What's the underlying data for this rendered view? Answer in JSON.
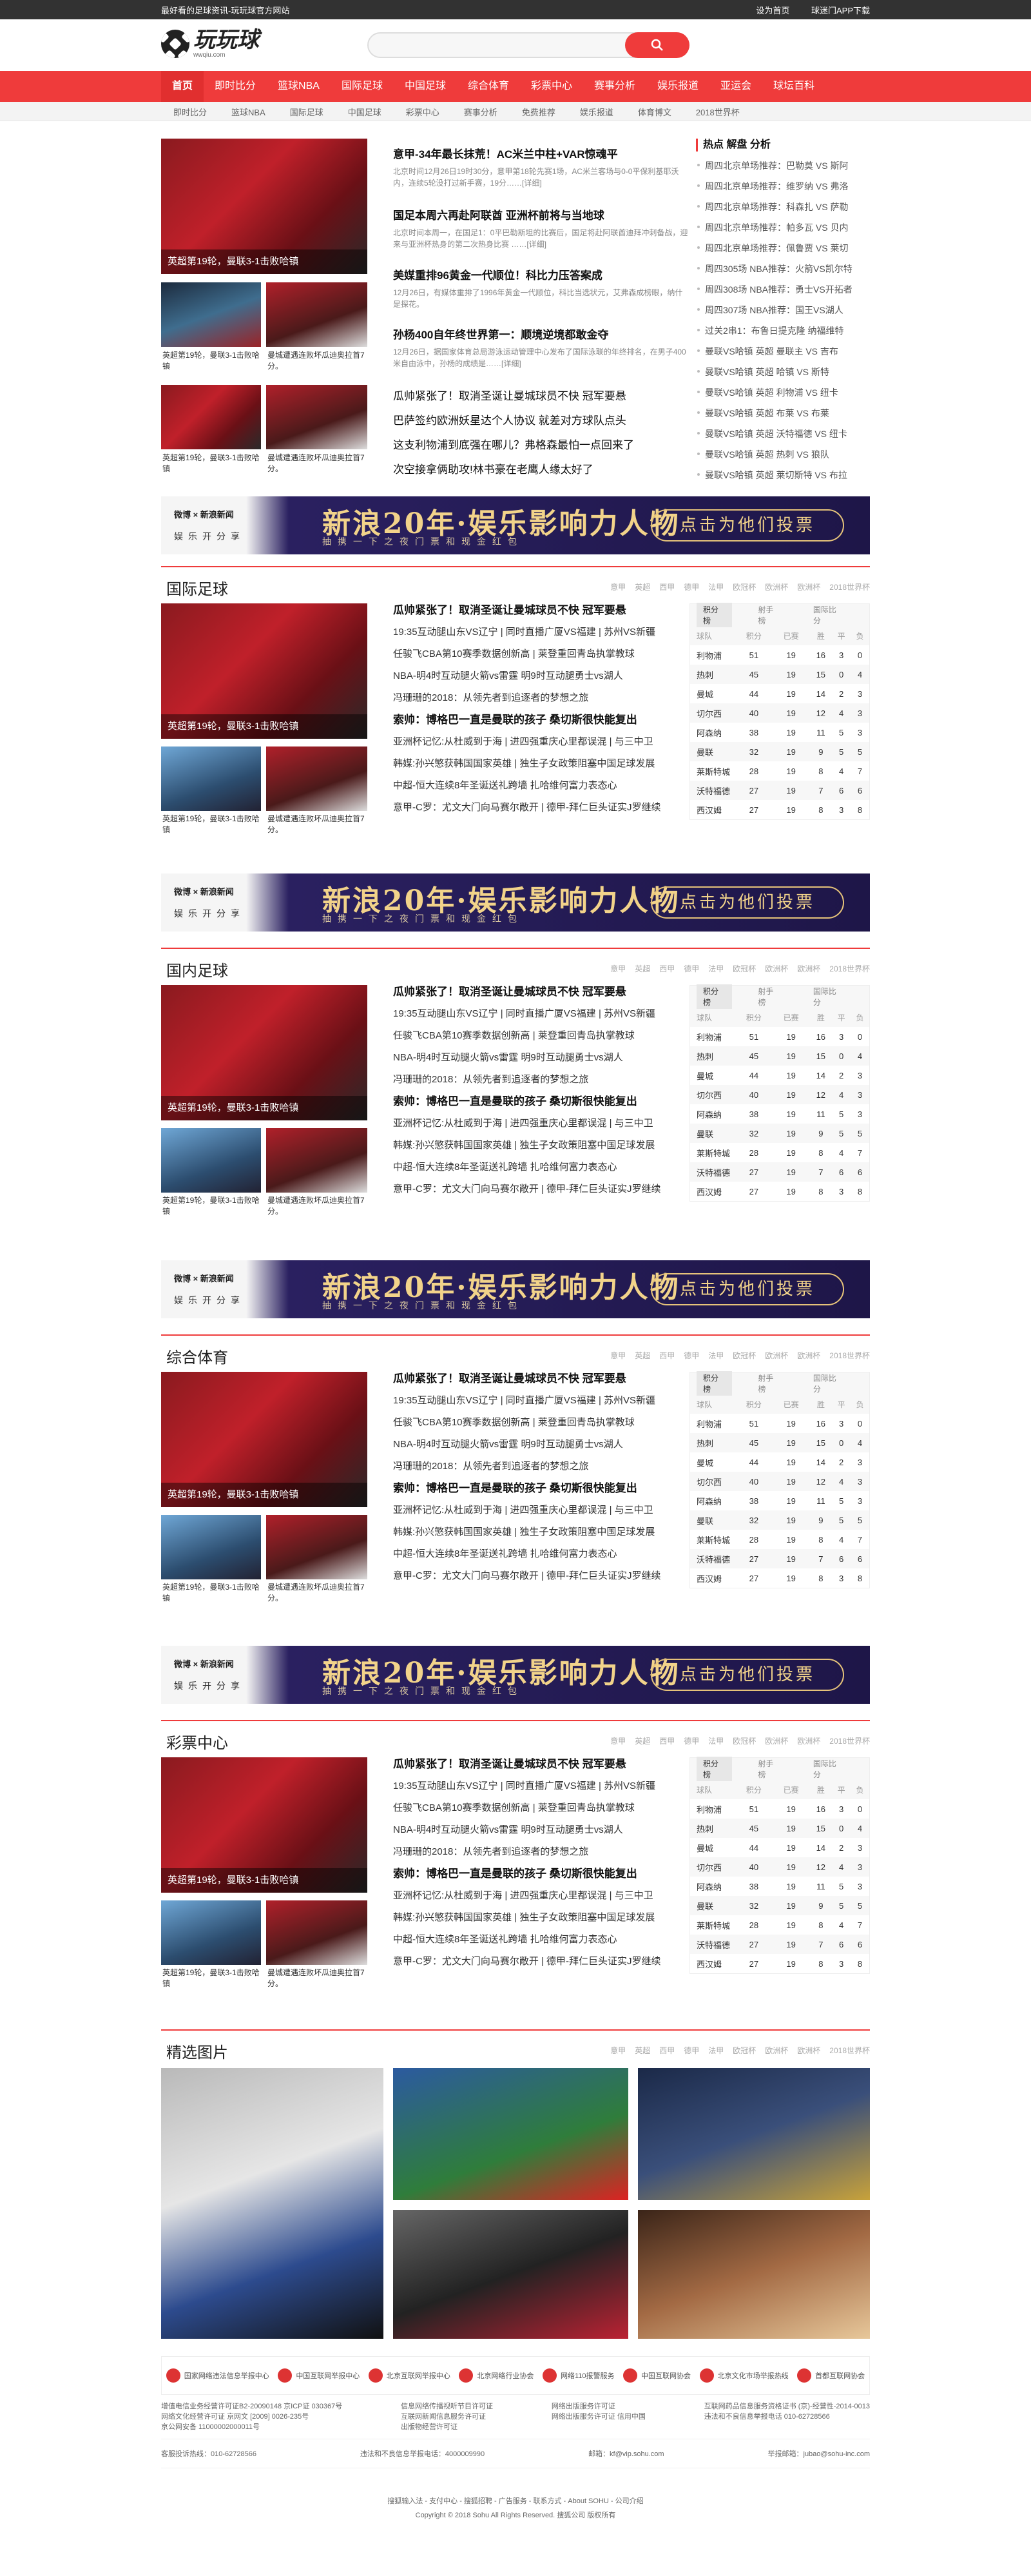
{
  "topbar": {
    "left": "最好看的足球资讯-玩玩球官方网站",
    "right1": "设为首页",
    "right2": "球迷门APP下载"
  },
  "logo": {
    "name": "玩玩球",
    "domain": "wwqiu.com"
  },
  "search": {
    "placeholder": "",
    "button_icon": "search-icon"
  },
  "nav": [
    "首页",
    "即时比分",
    "篮球NBA",
    "国际足球",
    "中国足球",
    "综合体育",
    "彩票中心",
    "赛事分析",
    "娱乐报道",
    "亚运会",
    "球坛百科"
  ],
  "subnav": [
    "即时比分",
    "篮球NBA",
    "国际足球",
    "中国足球",
    "彩票中心",
    "赛事分析",
    "免费推荐",
    "娱乐报道",
    "体育博文",
    "2018世界杯"
  ],
  "top": {
    "main_cap": "英超第19轮，曼联3-1击败哈镇",
    "small1": "英超第19轮，曼联3-1击败哈镇",
    "small2": "曼城遭遇连败坏瓜迪奥拉首7分。",
    "small3": "英超第19轮，曼联3-1击败哈镇",
    "small4": "曼城遭遇连败坏瓜迪奥拉首7分。",
    "h1": "意甲-34年最长抹荒！AC米兰中柱+VAR惊魂平",
    "s1": "北京时间12月26日19时30分，意甲第18轮先赛1场，AC米兰客场与0-0平保利基耶沃内，连续5轮没打过新手赛，19分……[详细]",
    "h2": "国足本周六再赴阿联酋 亚洲杯前将与当地球",
    "s2": "北京时间本周一，在国足1：0平巴勒斯坦的比赛后，国足将赴阿联酋迪拜冲刺备战，迎来与亚洲杯热身的第二次热身比赛 ……[详细]",
    "h3": "美媒重排96黄金一代顺位！科比力压答案成",
    "s3": "12月26日，有媒体重排了1996年黄金一代顺位，科比当选状元，艾弗森成榜眼，纳什是探花。",
    "h4": "孙杨400自年终世界第一：顺境逆境都敢金夺",
    "s4": "12月26日，据国家体育总局游泳运动管理中心发布了国际泳联的年终排名，在男子400米自由泳中，孙杨的成绩是……[详细]",
    "l1": "瓜帅紧张了！取消圣诞让曼城球员不快 冠军要悬",
    "l2": "巴萨签约欧洲妖星达个人协议 就差对方球队点头",
    "l3": "这支利物浦到底强在哪儿？弗格森最怕一点回来了",
    "l4": "次空接拿俩助攻!林书豪在老鹰人缘太好了"
  },
  "hot": {
    "title": "热点 解盘 分析",
    "items": [
      "周四北京单场推荐：巴勒莫 VS 斯阿",
      "周四北京单场推荐：维罗纳 VS 弗洛",
      "周四北京单场推荐：科森扎 VS 萨勒",
      "周四北京单场推荐：帕多瓦 VS 贝内",
      "周四北京单场推荐：佩鲁贾 VS 莱切",
      "周四305场 NBA推荐：火箭VS凯尔特",
      "周四308场 NBA推荐：勇士VS开拓者",
      "周四307场 NBA推荐：国王VS湖人",
      "过关2串1：布鲁日提克隆 纳福维特",
      "曼联VS哈镇 英超 曼联主 VS 吉布",
      "曼联VS哈镇 英超 哈镇 VS 斯特",
      "曼联VS哈镇 英超 利物浦 VS 纽卡",
      "曼联VS哈镇 英超 布莱 VS 布莱",
      "曼联VS哈镇 英超 沃特福德 VS 纽卡",
      "曼联VS哈镇 英超 热刺 VS 狼队",
      "曼联VS哈镇 英超 莱切斯特 VS 布拉"
    ]
  },
  "ad": {
    "logos": "微博 × 新浪新闻",
    "sub": "娱乐开分享",
    "big": "新浪20年·娱乐影响力人物",
    "sub2": "抽携一下之夜门票和现金红包",
    "vote": "点击为他们投票"
  },
  "sections": [
    {
      "title": "国际足球"
    },
    {
      "title": "国内足球"
    },
    {
      "title": "综合体育"
    },
    {
      "title": "彩票中心"
    }
  ],
  "tags": [
    "意甲",
    "英超",
    "西甲",
    "德甲",
    "法甲",
    "欧冠杯",
    "欧洲杯",
    "欧洲杯",
    "2018世界杯"
  ],
  "sec": {
    "big_cap": "英超第19轮，曼联3-1击败哈镇",
    "cap1": "英超第19轮，曼联3-1击败哈镇",
    "cap2": "曼城遭遇连败坏瓜迪奥拉首7分。",
    "b1": "瓜帅紧张了！取消圣诞让曼城球员不快 冠军要悬",
    "n1": "19:35互动腿山东VS辽宁 | 同时直播广厦VS福建 | 苏州VS新疆",
    "n2": "任骏飞CBA第10赛季数据创新高 | 莱登重回青岛执掌教球",
    "n3": "NBA-明4时互动腿火箭vs雷霆 明9时互动腿勇士vs湖人",
    "n4": "冯珊珊的2018：从领先者到追逐者的梦想之旅",
    "b2": "索帅：博格巴一直是曼联的孩子 桑切斯很快能复出",
    "n5": "亚洲杯记忆:从杜威到于海 | 进四强重庆心里都误混 | 与三中卫",
    "n6": "韩媒:孙兴慜获韩国国家英雄 | 独生子女政策阻塞中国足球发展",
    "n7": "中超-恒大连续8年圣诞送礼跨墙 扎哈维何富力表态心",
    "n8": "意甲-C罗：尤文大门向马赛尔敞开 | 德甲-拜仁巨头证实J罗继续"
  },
  "table": {
    "tab1": "积分榜",
    "tab2": "射手榜",
    "tab3": "国际比分",
    "head": [
      "球队",
      "积分",
      "已赛",
      "胜",
      "平",
      "负"
    ],
    "rows": [
      [
        "利物浦",
        "51",
        "19",
        "16",
        "3",
        "0"
      ],
      [
        "热刺",
        "45",
        "19",
        "15",
        "0",
        "4"
      ],
      [
        "曼城",
        "44",
        "19",
        "14",
        "2",
        "3"
      ],
      [
        "切尔西",
        "40",
        "19",
        "12",
        "4",
        "3"
      ],
      [
        "阿森纳",
        "38",
        "19",
        "11",
        "5",
        "3"
      ],
      [
        "曼联",
        "32",
        "19",
        "9",
        "5",
        "5"
      ],
      [
        "莱斯特城",
        "28",
        "19",
        "8",
        "4",
        "7"
      ],
      [
        "沃特福德",
        "27",
        "19",
        "7",
        "6",
        "6"
      ],
      [
        "西汉姆",
        "27",
        "19",
        "8",
        "3",
        "8"
      ]
    ]
  },
  "gallery": {
    "title": "精选图片"
  },
  "footer": {
    "logos": [
      "国家网络违法信息举报中心",
      "中国互联网举报中心",
      "北京互联网举报中心",
      "北京网络行业协会",
      "网络110报警服务",
      "中国互联网协会",
      "北京文化市场举报热线",
      "首都互联网协会"
    ],
    "c1": "增值电信业务经营许可证B2-20090148 京ICP证 030367号\n网络文化经营许可证 京网文 [2009] 0026-235号\n京公网安备 11000002000011号",
    "c2": "信息网络传播视听节目许可证\n互联网新闻信息服务许可证\n出版物经营许可证",
    "c3": "网络出版服务许可证\n网络出版服务许可证 信用中国",
    "c4": "互联网药品信息服务资格证书 (京)-经营性-2014-0013\n违法和不良信息举报电话 010-62728566",
    "tel1": "客服投诉热线：010-62728566",
    "tel2": "违法和不良信息举报电话：4000009990",
    "mail": "邮箱：kf@vip.sohu.com",
    "tel3": "举报邮箱：jubao@sohu-inc.com",
    "links": "搜狐输入法 - 支付中心 - 搜狐招聘 - 广告服务 - 联系方式 - About SOHU - 公司介绍",
    "copy": "Copyright © 2018 Sohu All Rights Reserved. 搜狐公司 版权所有"
  }
}
